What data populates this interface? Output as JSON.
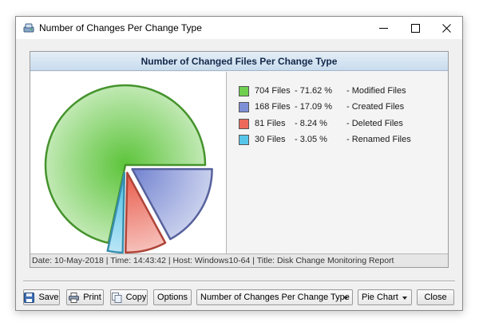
{
  "window": {
    "title": "Number of Changes Per Change Type",
    "icons": {
      "app": "disk-monitor-icon",
      "minimize": "minimize-icon",
      "maximize": "maximize-icon",
      "close": "close-icon"
    }
  },
  "chart": {
    "header_title": "Number of Changed Files Per Change Type",
    "footer_text": "Date: 10-May-2018 | Time: 14:43:42 | Host: Windows10-64 | Title: Disk Change Monitoring Report",
    "legend": [
      {
        "count": "704 Files",
        "pct": "-  71.62 %",
        "type": "-  Modified Files",
        "color": "#6fcf4f"
      },
      {
        "count": "168 Files",
        "pct": "-  17.09 %",
        "type": "-  Created Files",
        "color": "#7d8fd6"
      },
      {
        "count": "81 Files",
        "pct": "-  8.24 %",
        "type": "-  Deleted Files",
        "color": "#ec6a5a"
      },
      {
        "count": "30 Files",
        "pct": "-  3.05 %",
        "type": "-  Renamed Files",
        "color": "#56c5ea"
      }
    ]
  },
  "chart_data": {
    "type": "pie",
    "categories": [
      "Modified Files",
      "Created Files",
      "Deleted Files",
      "Renamed Files"
    ],
    "values": [
      704,
      168,
      81,
      30
    ],
    "percentages": [
      71.62,
      17.09,
      8.24,
      3.05
    ],
    "colors": [
      "#5cc43a",
      "#7283d0",
      "#e85a4a",
      "#49bde6"
    ],
    "exploded": [
      false,
      true,
      true,
      true
    ],
    "title": "Number of Changed Files Per Change Type",
    "legend_position": "right"
  },
  "toolbar": {
    "save_label": "Save",
    "print_label": "Print",
    "copy_label": "Copy",
    "options_label": "Options",
    "report_select_value": "Number of Changes Per Change Type",
    "chart_type_value": "Pie Chart",
    "close_label": "Close",
    "icons": {
      "save": "save-icon",
      "print": "printer-icon",
      "copy": "copy-icon"
    }
  }
}
